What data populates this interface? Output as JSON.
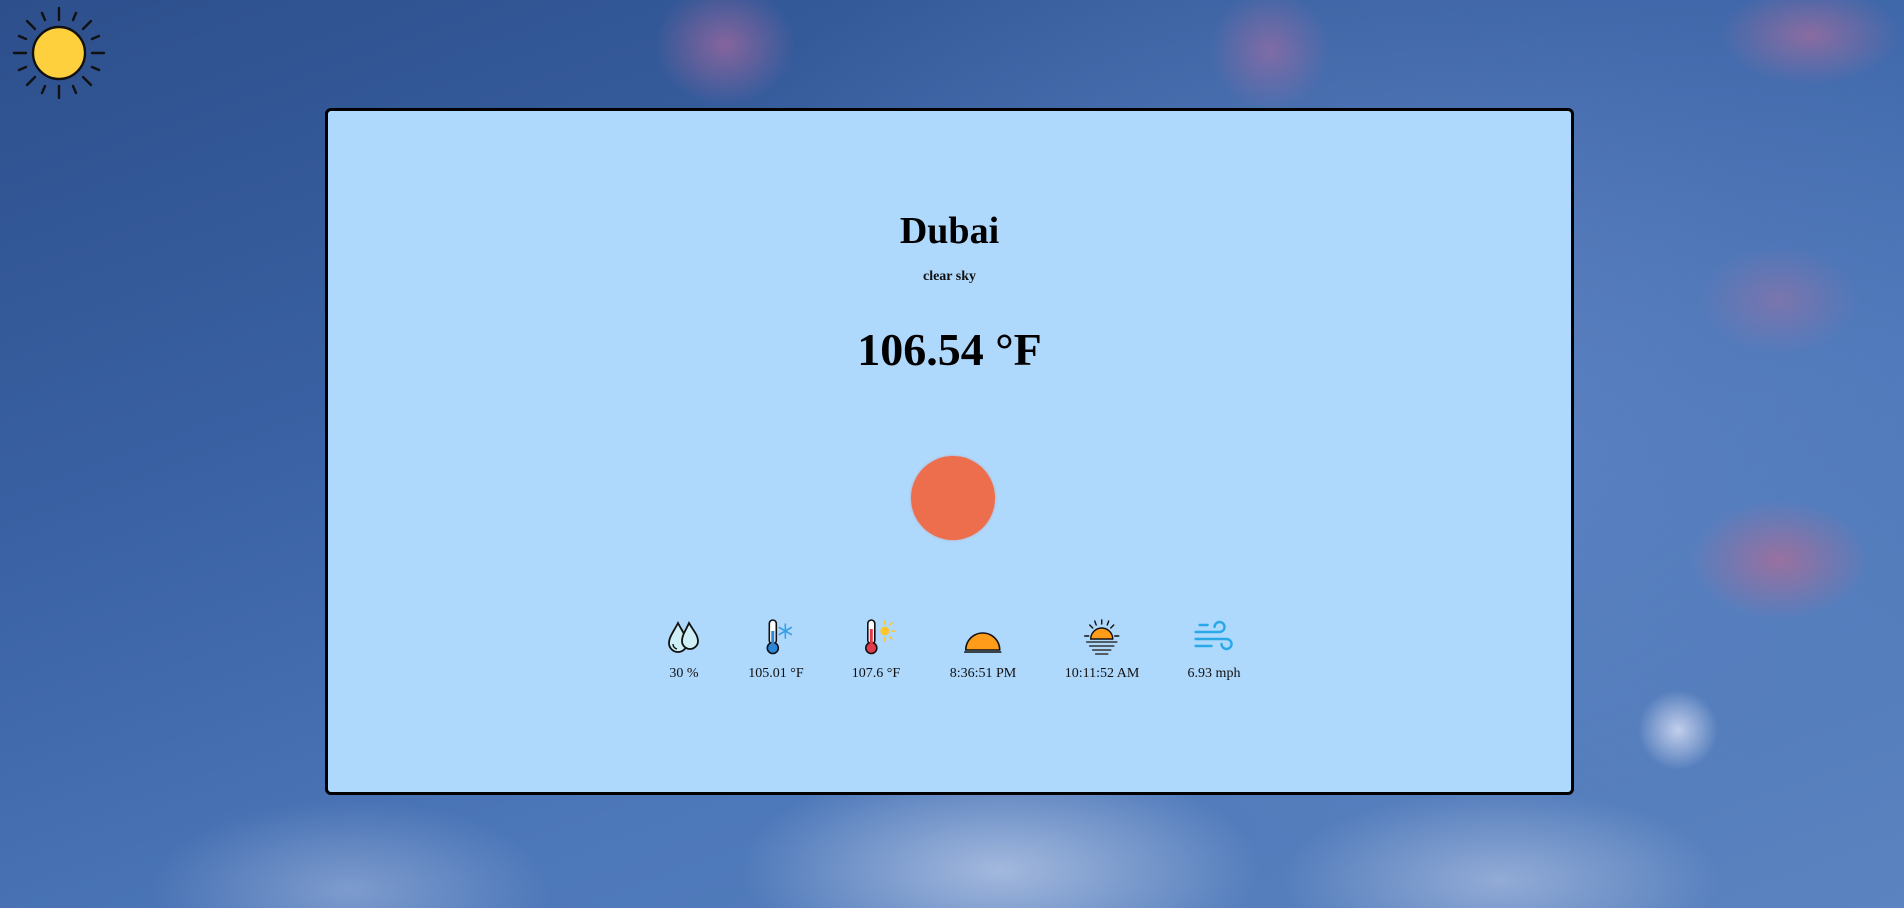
{
  "logo": {
    "icon": "sun-icon",
    "color": "#ffd03d"
  },
  "weather": {
    "city": "Dubai",
    "description": "clear sky",
    "temperature": "106.54 °F",
    "condition_icon": "sun-circle-icon",
    "condition_color": "#ec6e4c"
  },
  "stats": [
    {
      "icon": "humidity-icon",
      "value": "30 %"
    },
    {
      "icon": "min-temperature-icon",
      "value": "105.01 °F"
    },
    {
      "icon": "max-temperature-icon",
      "value": "107.6 °F"
    },
    {
      "icon": "sunset-icon",
      "value": "8:36:51 PM"
    },
    {
      "icon": "sunrise-icon",
      "value": "10:11:52 AM"
    },
    {
      "icon": "wind-icon",
      "value": "6.93 mph"
    }
  ],
  "colors": {
    "card_background": "#aed8fc",
    "card_border": "#000000",
    "accent_orange": "#ff9d1a",
    "wind_blue": "#29a9e8"
  }
}
